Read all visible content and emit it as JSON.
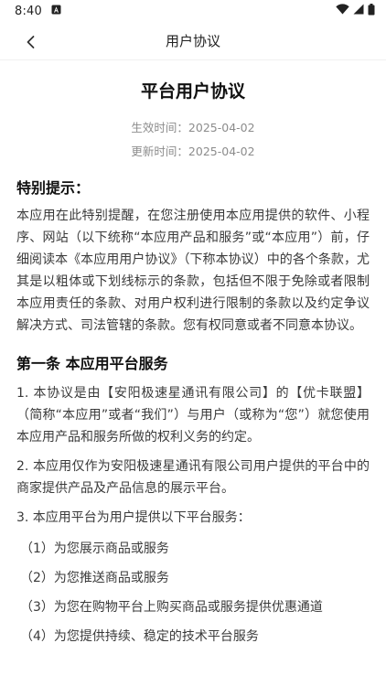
{
  "status_bar": {
    "time": "8:40",
    "notification_icon": "a-box-icon",
    "wifi_icon": "wifi-icon",
    "signal_icon": "cell-signal-icon",
    "battery_icon": "battery-icon"
  },
  "app_bar": {
    "back_icon": "chevron-left-icon",
    "title": "用户协议"
  },
  "document": {
    "title": "平台用户协议",
    "effective_date": "生效时间：2025-04-02",
    "updated_date": "更新时间：2025-04-02",
    "notice_heading": "特别提示：",
    "notice_text": "本应用在此特别提醒，在您注册使用本应用提供的软件、小程序、网站（以下统称“本应用产品和服务”或“本应用”）前，仔细阅读本《本应用用户协议》（下称本协议）中的各个条款，尤其是以粗体或下划线标示的条款，包括但不限于免除或者限制本应用责任的条款、对用户权利进行限制的条款以及约定争议解决方式、司法管辖的条款。您有权同意或者不同意本协议。",
    "article1": {
      "heading": "第一条 本应用平台服务",
      "paragraphs": [
        "1. 本协议是由【安阳极速星通讯有限公司】的【优卡联盟】（简称“本应用”或者“我们”）与用户（或称为“您”）就您使用本应用产品和服务所做的权利义务的约定。",
        "2. 本应用仅作为安阳极速星通讯有限公司用户提供的平台中的商家提供产品及产品信息的展示平台。",
        "3. 本应用平台为用户提供以下平台服务："
      ],
      "items": [
        "（1）为您展示商品或服务",
        "（2）为您推送商品或服务",
        "（3）为您在购物平台上购买商品或服务提供优惠通道",
        "（4）为您提供持续、稳定的技术平台服务"
      ]
    }
  },
  "colors": {
    "background": "#ffffff",
    "text": "#3a3a3a",
    "heading": "#111111",
    "meta": "#8c8c8c"
  }
}
